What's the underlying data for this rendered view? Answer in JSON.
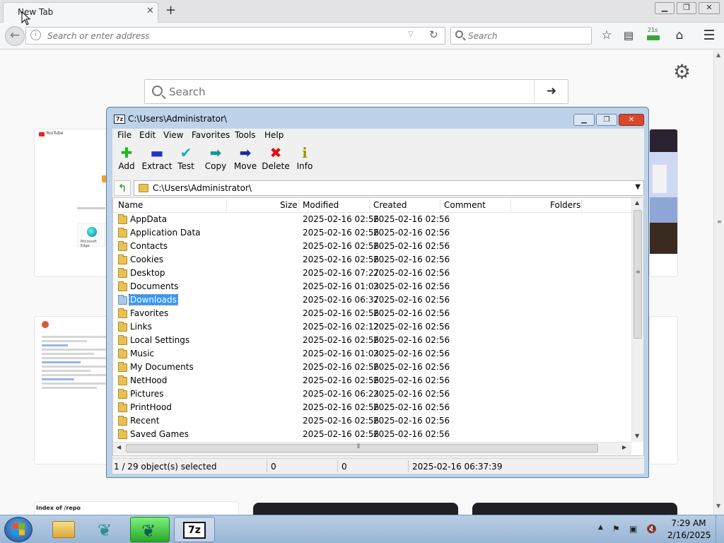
{
  "browser": {
    "tab_title": "New Tab",
    "url_placeholder": "Search or enter address",
    "search_placeholder": "Search",
    "badge": "21s",
    "ntp_search_placeholder": "Search",
    "tile_labels": {
      "youtube": "YouTube",
      "edge": "Microsoft Edge",
      "index": "Index of /repo"
    }
  },
  "sevenzip": {
    "title": "C:\\Users\\Administrator\\",
    "menu": [
      "File",
      "Edit",
      "View",
      "Favorites",
      "Tools",
      "Help"
    ],
    "toolbar": [
      {
        "label": "Add",
        "icon": "add-icon",
        "glyph": "✚",
        "color": "#1db81d"
      },
      {
        "label": "Extract",
        "icon": "extract-icon",
        "glyph": "▬",
        "color": "#2233cc"
      },
      {
        "label": "Test",
        "icon": "test-icon",
        "glyph": "✔",
        "color": "#15b0b0"
      },
      {
        "label": "Copy",
        "icon": "copy-icon",
        "glyph": "➡",
        "color": "#129a8a"
      },
      {
        "label": "Move",
        "icon": "move-icon",
        "glyph": "➡",
        "color": "#1f2a9a"
      },
      {
        "label": "Delete",
        "icon": "delete-icon",
        "glyph": "✖",
        "color": "#d11"
      },
      {
        "label": "Info",
        "icon": "info-icon",
        "glyph": "i",
        "color": "#9a9a00"
      }
    ],
    "path": "C:\\Users\\Administrator\\",
    "columns": [
      "Name",
      "Size",
      "Modified",
      "Created",
      "Comment",
      "Folders"
    ],
    "rows": [
      {
        "name": "AppData",
        "modified": "2025-02-16 02:56",
        "created": "2025-02-16 02:56"
      },
      {
        "name": "Application Data",
        "modified": "2025-02-16 02:56",
        "created": "2025-02-16 02:56"
      },
      {
        "name": "Contacts",
        "modified": "2025-02-16 02:56",
        "created": "2025-02-16 02:56"
      },
      {
        "name": "Cookies",
        "modified": "2025-02-16 02:56",
        "created": "2025-02-16 02:56"
      },
      {
        "name": "Desktop",
        "modified": "2025-02-16 07:27",
        "created": "2025-02-16 02:56"
      },
      {
        "name": "Documents",
        "modified": "2025-02-16 01:03",
        "created": "2025-02-16 02:56"
      },
      {
        "name": "Downloads",
        "modified": "2025-02-16 06:37",
        "created": "2025-02-16 02:56",
        "selected": true
      },
      {
        "name": "Favorites",
        "modified": "2025-02-16 02:56",
        "created": "2025-02-16 02:56"
      },
      {
        "name": "Links",
        "modified": "2025-02-16 02:12",
        "created": "2025-02-16 02:56"
      },
      {
        "name": "Local Settings",
        "modified": "2025-02-16 02:56",
        "created": "2025-02-16 02:56"
      },
      {
        "name": "Music",
        "modified": "2025-02-16 01:03",
        "created": "2025-02-16 02:56"
      },
      {
        "name": "My Documents",
        "modified": "2025-02-16 02:56",
        "created": "2025-02-16 02:56"
      },
      {
        "name": "NetHood",
        "modified": "2025-02-16 02:56",
        "created": "2025-02-16 02:56"
      },
      {
        "name": "Pictures",
        "modified": "2025-02-16 06:23",
        "created": "2025-02-16 02:56"
      },
      {
        "name": "PrintHood",
        "modified": "2025-02-16 02:56",
        "created": "2025-02-16 02:56"
      },
      {
        "name": "Recent",
        "modified": "2025-02-16 02:56",
        "created": "2025-02-16 02:56"
      },
      {
        "name": "Saved Games",
        "modified": "2025-02-16 02:56",
        "created": "2025-02-16 02:56"
      }
    ],
    "status": {
      "selected": "1 / 29 object(s) selected",
      "size": "0",
      "packed": "0",
      "modified": "2025-02-16 06:37:39"
    }
  },
  "taskbar": {
    "time": "7:29 AM",
    "date": "2/16/2025",
    "sevenzip_label": "7z"
  }
}
